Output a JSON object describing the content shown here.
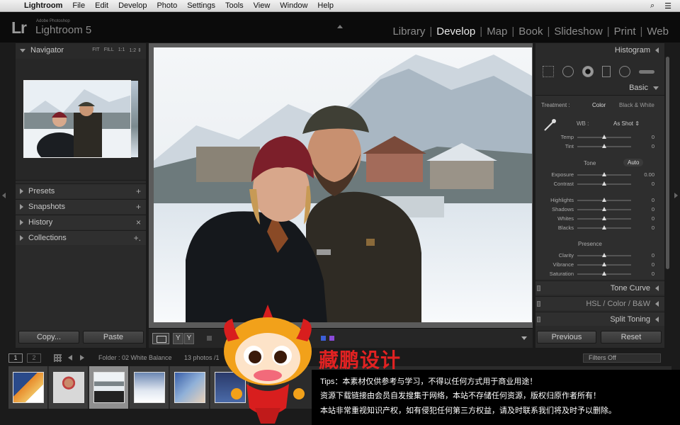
{
  "menubar": {
    "app_name": "Lightroom",
    "items": [
      "File",
      "Edit",
      "Develop",
      "Photo",
      "Settings",
      "Tools",
      "View",
      "Window",
      "Help"
    ],
    "right_icons": [
      "search-icon",
      "list-icon"
    ]
  },
  "identity": {
    "logo": "Lr",
    "adobe_label": "Adobe Photoshop",
    "product": "Lightroom 5"
  },
  "modules": [
    "Library",
    "Develop",
    "Map",
    "Book",
    "Slideshow",
    "Print",
    "Web"
  ],
  "active_module": "Develop",
  "left_panel": {
    "navigator": {
      "title": "Navigator",
      "zoom_options": [
        "FIT",
        "FILL",
        "1:1",
        "1:2 ⇕"
      ]
    },
    "sections": [
      {
        "label": "Presets",
        "action": "+"
      },
      {
        "label": "Snapshots",
        "action": "+"
      },
      {
        "label": "History",
        "action": "×"
      },
      {
        "label": "Collections",
        "action": "+."
      }
    ],
    "copy_button": "Copy...",
    "paste_button": "Paste"
  },
  "right_panel": {
    "histogram_title": "Histogram",
    "basic_title": "Basic",
    "treatment": {
      "label": "Treatment :",
      "option_color": "Color",
      "option_bw": "Black & White"
    },
    "wb": {
      "label": "WB :",
      "value": "As Shot ⇕"
    },
    "wb_sliders": [
      {
        "label": "Temp",
        "value": "0",
        "pos": 0.5
      },
      {
        "label": "Tint",
        "value": "0",
        "pos": 0.5
      }
    ],
    "tone": {
      "label": "Tone",
      "auto": "Auto"
    },
    "tone_sliders_a": [
      {
        "label": "Exposure",
        "value": "0.00",
        "pos": 0.5
      },
      {
        "label": "Contrast",
        "value": "0",
        "pos": 0.5
      }
    ],
    "tone_sliders_b": [
      {
        "label": "Highlights",
        "value": "0",
        "pos": 0.5
      },
      {
        "label": "Shadows",
        "value": "0",
        "pos": 0.5
      },
      {
        "label": "Whites",
        "value": "0",
        "pos": 0.5
      },
      {
        "label": "Blacks",
        "value": "0",
        "pos": 0.5
      }
    ],
    "presence": {
      "label": "Presence"
    },
    "presence_sliders": [
      {
        "label": "Clarity",
        "value": "0",
        "pos": 0.5
      },
      {
        "label": "Vibrance",
        "value": "0",
        "pos": 0.5
      },
      {
        "label": "Saturation",
        "value": "0",
        "pos": 0.5
      }
    ],
    "sections": [
      "Tone Curve",
      "HSL / Color / B&W",
      "Split Toning"
    ],
    "previous_button": "Previous",
    "reset_button": "Reset"
  },
  "toolbar": {
    "yy_a": "Y",
    "yy_b": "Y"
  },
  "filmstrip_bar": {
    "screen1": "1",
    "screen2": "2",
    "source": "Folder : 02 White Balance",
    "count": "13 photos /1",
    "filter": "Filters Off"
  },
  "watermark": {
    "title": "藏鹏设计",
    "line1": "Tips：本素材仅供参考与学习，不得以任何方式用于商业用途！",
    "line2": "资源下载链接由会员自发搜集于网络，本站不存储任何资源，版权归原作者所有！",
    "line3": "本站非常重视知识产权，如有侵犯任何第三方权益，请及时联系我们将及时予以删除。"
  }
}
